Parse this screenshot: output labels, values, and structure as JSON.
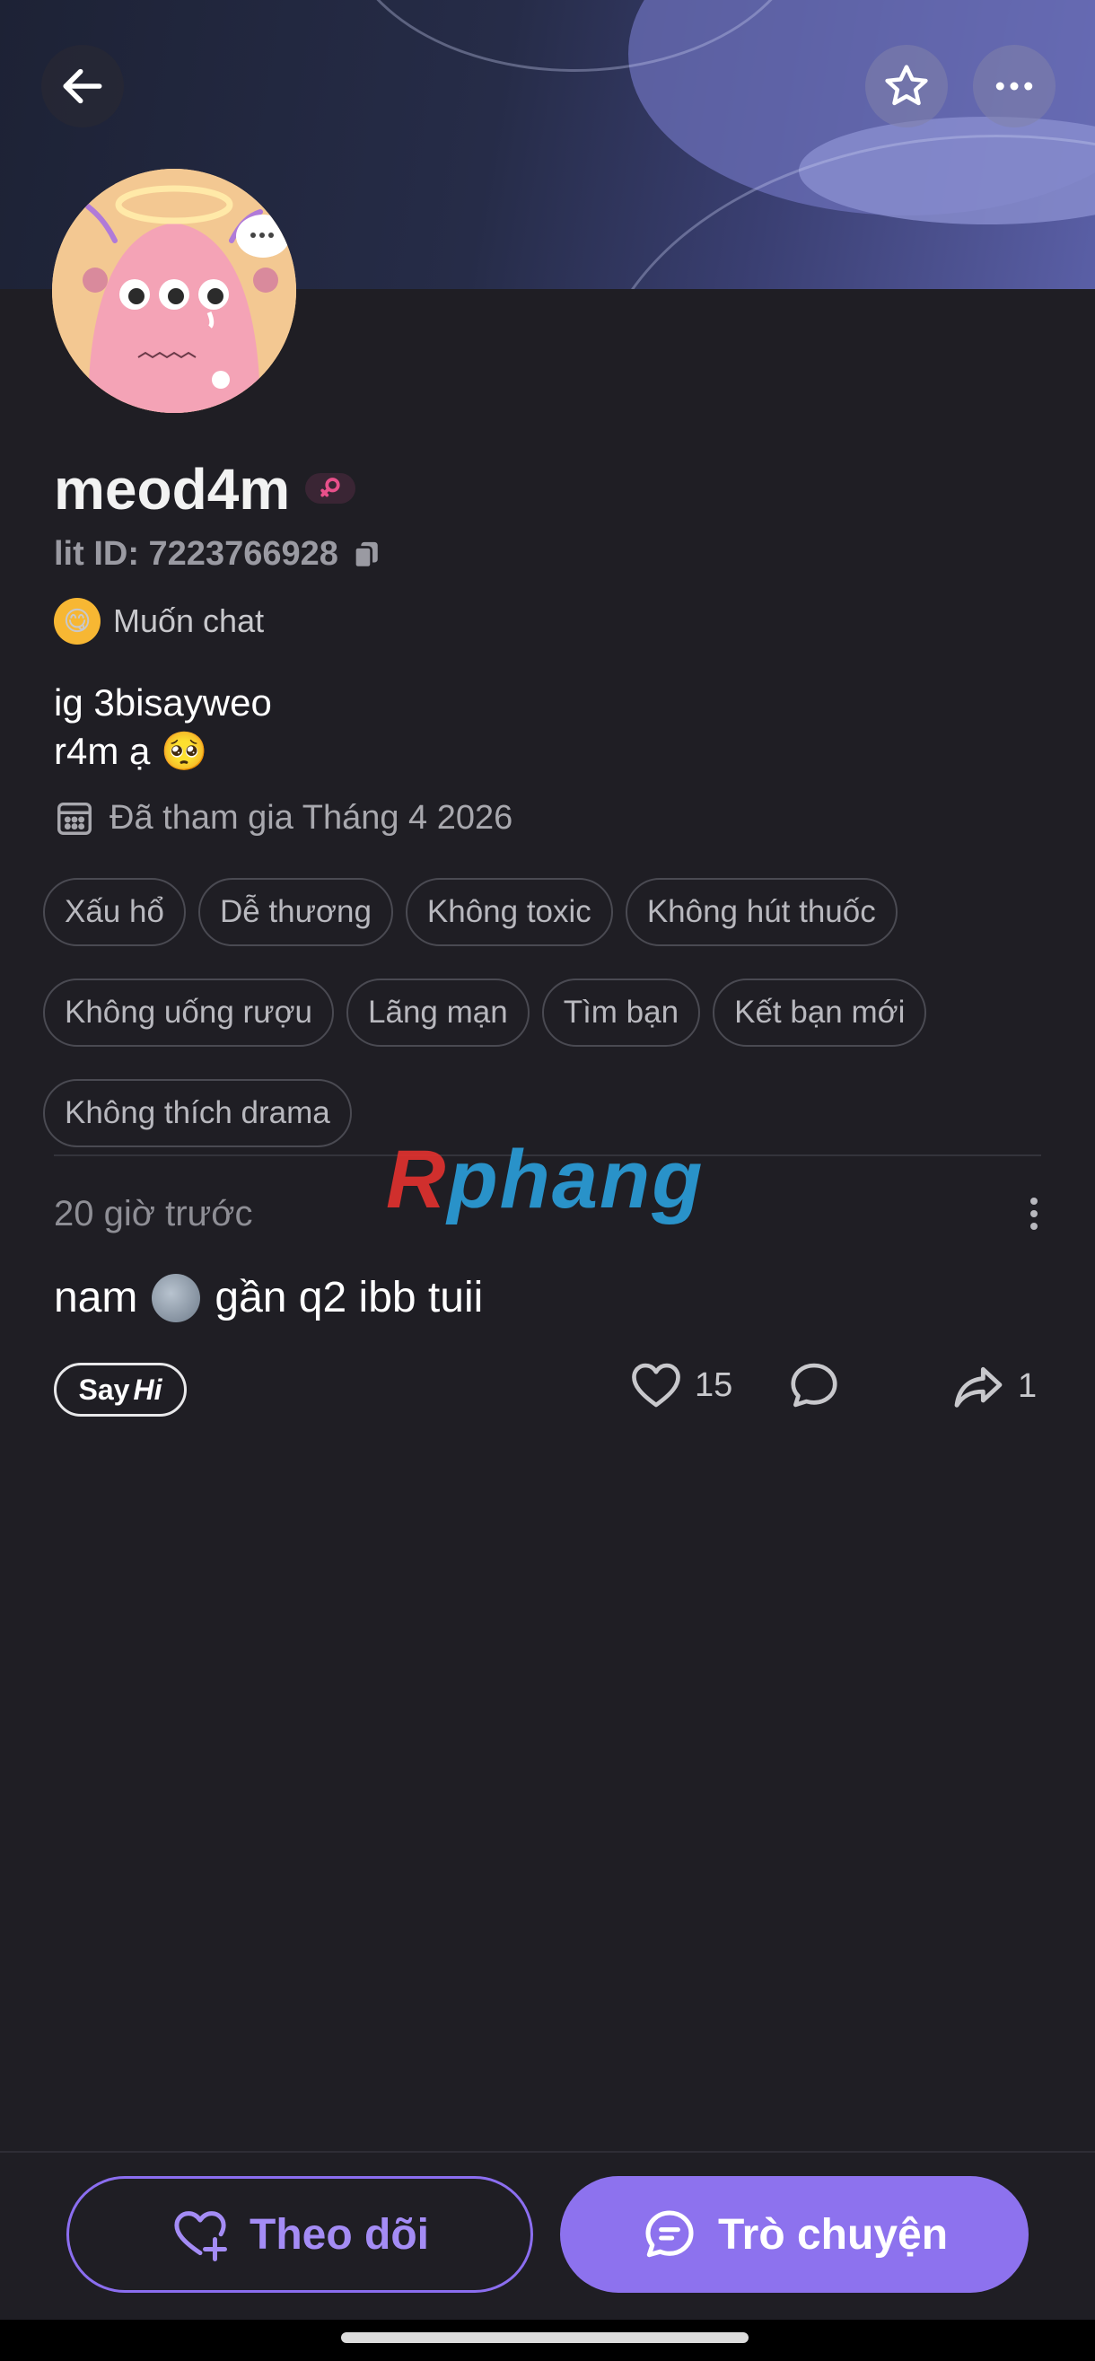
{
  "header": {
    "back_icon": "arrow-left-icon",
    "favorite_icon": "star-icon",
    "more_icon": "more-horizontal-icon"
  },
  "profile": {
    "username": "meod4m",
    "gender_icon": "female-icon",
    "lit_id": "lit ID: 7223766928",
    "copy_icon": "copy-icon",
    "status": "Muốn chat",
    "status_emoji": "😋",
    "bio_line1": "ig 3bisayweo",
    "bio_line2": "r4m ạ",
    "bio_emoji": "🥺",
    "joined": "Đã tham gia Tháng 4 2026",
    "calendar_icon": "calendar-icon"
  },
  "tags": {
    "row1": [
      "Xấu hổ",
      "Dễ thương",
      "Không toxic",
      "Không hút thuốc"
    ],
    "row2": [
      "Không uống rượu",
      "Lãng mạn",
      "Tìm bạn",
      "Kết bạn mới"
    ],
    "row3": [
      "Không thích drama"
    ]
  },
  "watermark": {
    "first": "R",
    "rest": "phang"
  },
  "post": {
    "time": "20 giờ trước",
    "text_before": "nam",
    "text_after": "gần q2 ibb tuii",
    "sayhi_say": "Say",
    "sayhi_hi": "Hi",
    "likes": "15",
    "shares": "1"
  },
  "actions": {
    "follow_label": "Theo dõi",
    "chat_label": "Trò chuyện"
  },
  "colors": {
    "background": "#1f1e24",
    "accent": "#8d72ee",
    "accent_text": "#a48cf5"
  }
}
